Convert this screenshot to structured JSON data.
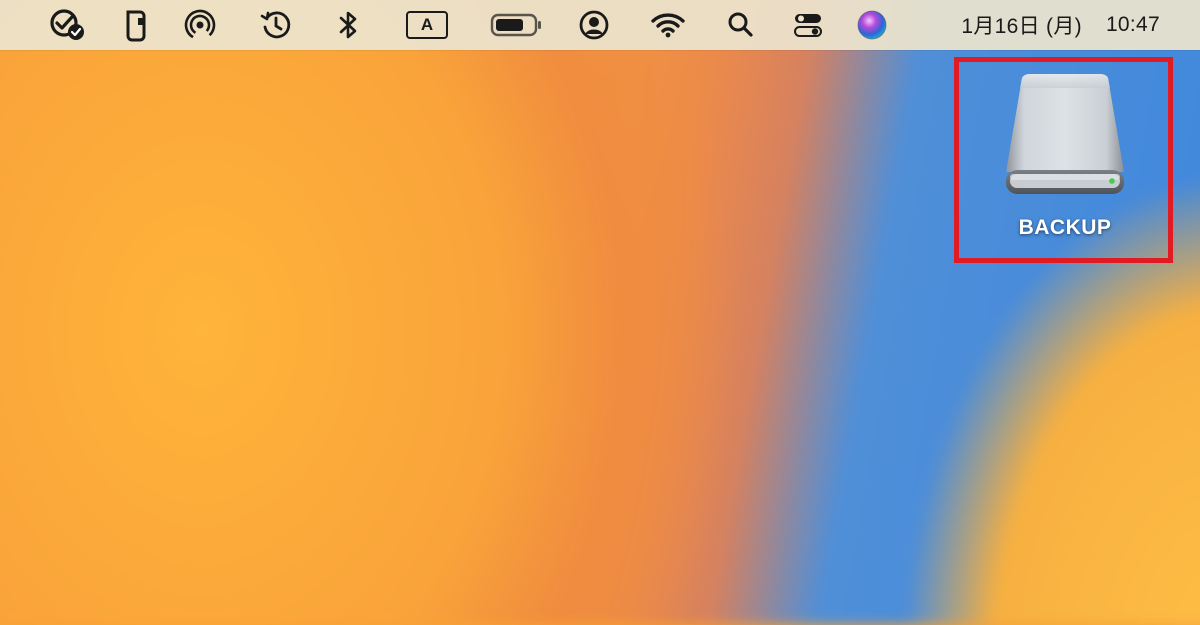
{
  "menubar": {
    "icons": [
      "checkmark-badge-icon",
      "phone-device-icon",
      "airdrop-icon",
      "time-machine-icon",
      "bluetooth-icon",
      "input-source-icon",
      "battery-icon",
      "user-account-icon",
      "wifi-icon",
      "spotlight-search-icon",
      "control-center-icon",
      "siri-icon"
    ],
    "input_source_label": "A",
    "date": "1月16日 (月)",
    "time": "10:47"
  },
  "desktop": {
    "drive": {
      "label": "BACKUP",
      "icon": "external-drive-icon",
      "highlight_color": "#e01b24"
    }
  },
  "colors": {
    "wallpaper_orange": "#f8a039",
    "wallpaper_blue": "#3d86de",
    "menubar_bg": "#ece4cd"
  }
}
